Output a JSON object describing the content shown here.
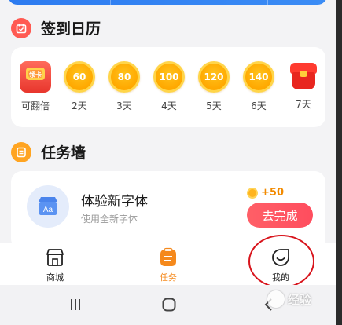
{
  "checkin": {
    "title": "签到日历",
    "days": [
      {
        "kind": "gift",
        "badge": "领卡",
        "label": "可翻倍"
      },
      {
        "kind": "coin",
        "value": "60",
        "label": "2天"
      },
      {
        "kind": "coin",
        "value": "80",
        "label": "3天"
      },
      {
        "kind": "coin",
        "value": "100",
        "label": "4天"
      },
      {
        "kind": "coin",
        "value": "120",
        "label": "5天"
      },
      {
        "kind": "coin",
        "value": "140",
        "label": "6天"
      },
      {
        "kind": "redbag",
        "label": "7天"
      }
    ]
  },
  "tasks": {
    "title": "任务墙",
    "items": [
      {
        "title": "体验新字体",
        "desc": "使用全新字体",
        "reward": "+50",
        "button": "去完成",
        "icon": "font-store-icon"
      }
    ]
  },
  "tabbar": {
    "items": [
      {
        "label": "商城",
        "icon": "shop-icon",
        "active": false
      },
      {
        "label": "任务",
        "icon": "clipboard-icon",
        "active": true
      },
      {
        "label": "我的",
        "icon": "profile-face-icon",
        "active": false
      }
    ]
  },
  "watermark": {
    "text": "经验"
  },
  "colors": {
    "accent": "#f5891c",
    "button": "#ff5563",
    "coin": "#ffb000",
    "annotation": "#d8141c"
  }
}
